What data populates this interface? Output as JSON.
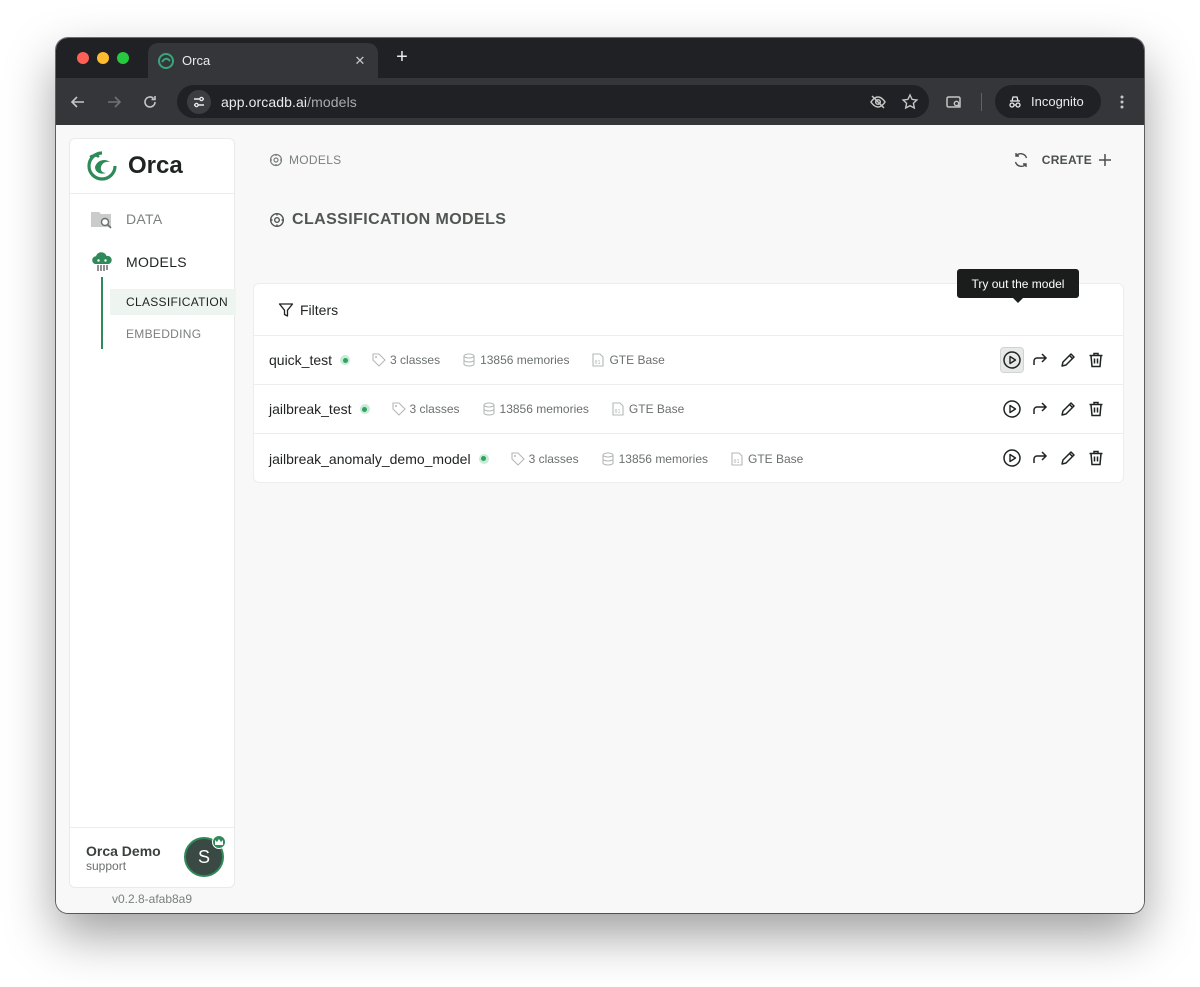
{
  "browser": {
    "tab_title": "Orca",
    "url_host": "app.orcadb.ai",
    "url_path": "/models",
    "incognito_label": "Incognito"
  },
  "sidebar": {
    "brand": "Orca",
    "nav": [
      {
        "label": "DATA",
        "icon": "folder-search-icon"
      },
      {
        "label": "MODELS",
        "icon": "orca-cloud-icon"
      }
    ],
    "subnav": [
      {
        "label": "CLASSIFICATION",
        "active": true
      },
      {
        "label": "EMBEDDING",
        "active": false
      }
    ],
    "user": {
      "name": "Orca Demo",
      "role": "support",
      "avatar_initial": "S"
    },
    "version": "v0.2.8-afab8a9"
  },
  "header": {
    "breadcrumb": "MODELS",
    "create_label": "CREATE"
  },
  "main": {
    "section_title": "CLASSIFICATION MODELS",
    "filters_label": "Filters",
    "tooltip": "Try out the model",
    "models": [
      {
        "name": "quick_test",
        "classes": "3 classes",
        "memories": "13856 memories",
        "embedding": "GTE Base"
      },
      {
        "name": "jailbreak_test",
        "classes": "3 classes",
        "memories": "13856 memories",
        "embedding": "GTE Base"
      },
      {
        "name": "jailbreak_anomaly_demo_model",
        "classes": "3 classes",
        "memories": "13856 memories",
        "embedding": "GTE Base"
      }
    ]
  },
  "colors": {
    "accent": "#2f8a5a",
    "status_ready": "#2ea262"
  }
}
